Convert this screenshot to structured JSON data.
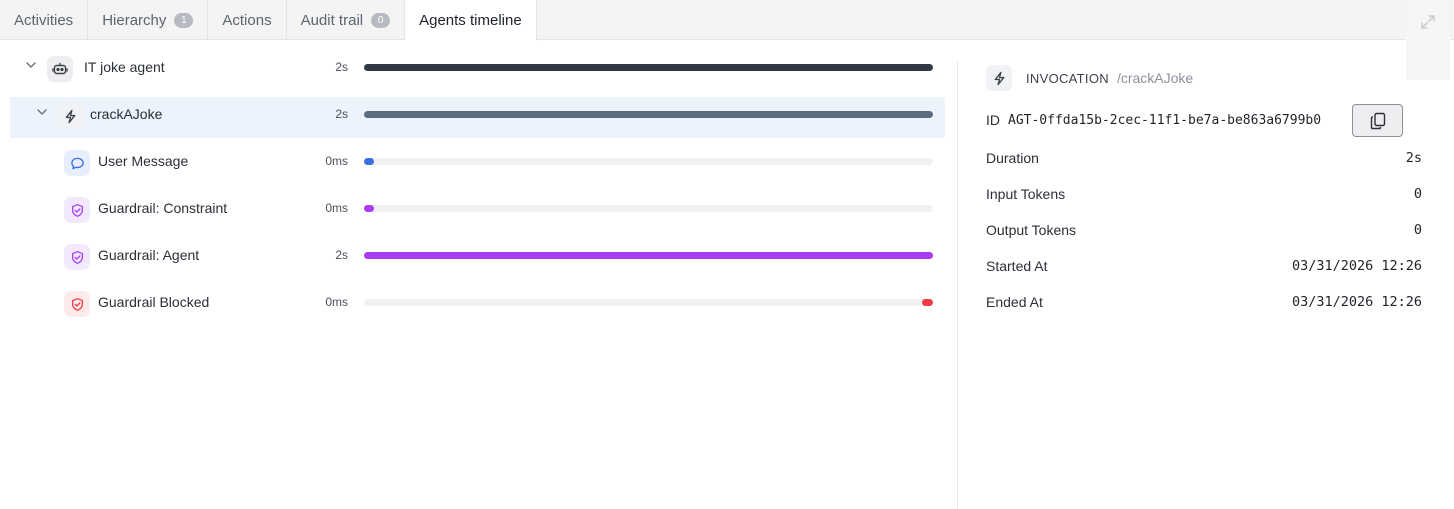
{
  "tabs": [
    {
      "label": "Activities",
      "badge": null,
      "active": false
    },
    {
      "label": "Hierarchy",
      "badge": "1",
      "active": false
    },
    {
      "label": "Actions",
      "badge": null,
      "active": false
    },
    {
      "label": "Audit trail",
      "badge": "0",
      "active": false
    },
    {
      "label": "Agents timeline",
      "badge": null,
      "active": true
    }
  ],
  "tree": [
    {
      "label": "IT joke agent",
      "duration": "2s",
      "icon": "robot-icon",
      "level": 0,
      "expandable": true,
      "bar_start": 0.0,
      "bar_end": 1.0,
      "bar_color": "#323845"
    },
    {
      "label": "crackAJoke",
      "duration": "2s",
      "icon": "lightning-icon",
      "level": 1,
      "expandable": true,
      "selected": true,
      "bar_start": 0.0,
      "bar_end": 1.0,
      "bar_color": "#5c6b80"
    },
    {
      "label": "User Message",
      "duration": "0ms",
      "icon": "message-icon",
      "level": 2,
      "bar_start": 0.0,
      "bar_end": 0.018,
      "bar_color": "#3b6fe0"
    },
    {
      "label": "Guardrail: Constraint",
      "duration": "0ms",
      "icon": "shield-check-icon",
      "level": 2,
      "bar_start": 0.0,
      "bar_end": 0.018,
      "bar_color": "#a93df5"
    },
    {
      "label": "Guardrail: Agent",
      "duration": "2s",
      "icon": "shield-check-icon",
      "level": 2,
      "bar_start": 0.0,
      "bar_end": 1.0,
      "bar_color": "#a93df5"
    },
    {
      "label": "Guardrail Blocked",
      "duration": "0ms",
      "icon": "shield-alert-icon",
      "level": 2,
      "bar_start": 0.98,
      "bar_end": 1.0,
      "bar_color": "#ef3b46"
    }
  ],
  "detail": {
    "type": "INVOCATION",
    "path": "/crackAJoke",
    "id_label": "ID",
    "id_value": "AGT-0ffda15b-2cec-11f1-be7a-be863a6799b0",
    "properties": [
      {
        "key": "Duration",
        "value": "2s"
      },
      {
        "key": "Input Tokens",
        "value": "0"
      },
      {
        "key": "Output Tokens",
        "value": "0"
      },
      {
        "key": "Started At",
        "value": "03/31/2026 12:26"
      },
      {
        "key": "Ended At",
        "value": "03/31/2026 12:26"
      }
    ]
  },
  "colors": {
    "robot_icon_bg": "#eeeef1",
    "lightning_icon_bg": "#f1f2f5",
    "message_icon_bg": "#e7effc",
    "shield_check_icon_bg": "#f3e9fd",
    "shield_alert_icon_bg": "#fdeaeb"
  }
}
